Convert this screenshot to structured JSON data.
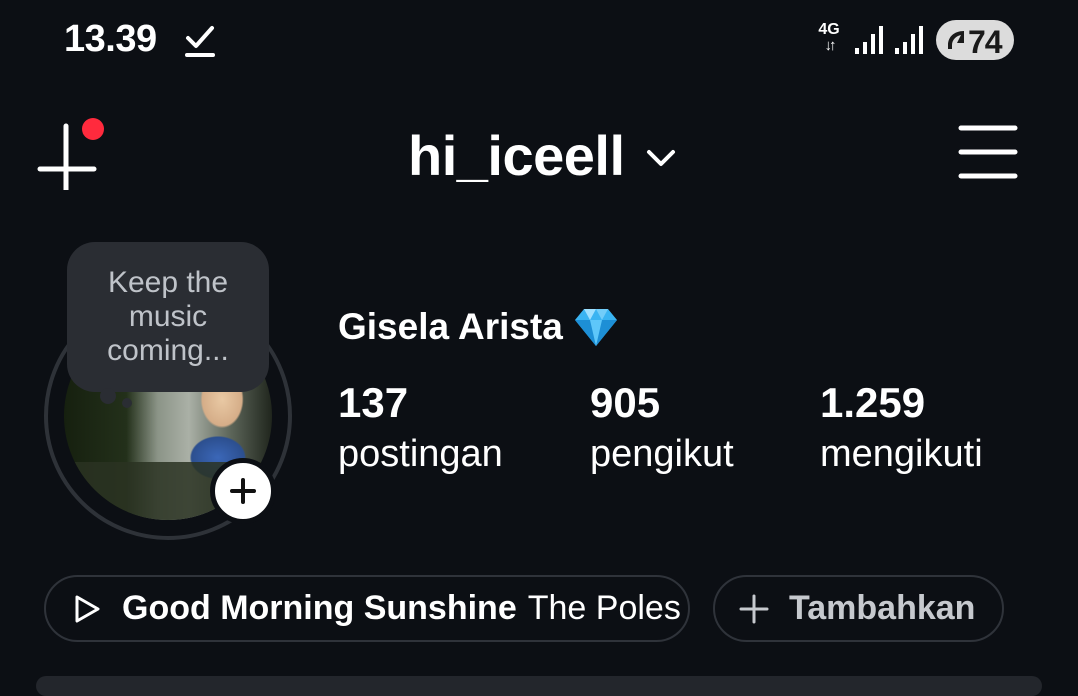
{
  "status_bar": {
    "time": "13.39",
    "network": "4G",
    "network_arrows": "↓↑",
    "battery": "74",
    "icons": [
      "download-done-icon",
      "signal-icon",
      "signal-icon",
      "battery-saver-icon"
    ]
  },
  "header": {
    "username": "hi_iceell",
    "icons": {
      "create": "plus-icon",
      "dropdown": "chevron-down-icon",
      "menu": "hamburger-menu-icon"
    },
    "notification_color": "#ff2a3d"
  },
  "profile": {
    "note": "Keep the music coming...",
    "display_name": "Gisela Arista",
    "name_icon": "diamond-icon",
    "stats": [
      {
        "value": "137",
        "label": "postingan"
      },
      {
        "value": "905",
        "label": "pengikut"
      },
      {
        "value": "1.259",
        "label": "mengikuti"
      }
    ]
  },
  "music": {
    "song": "Good Morning Sunshine",
    "artist": "The Poles",
    "icon": "play-icon"
  },
  "add_button": {
    "label": "Tambahkan",
    "icon": "plus-icon"
  },
  "colors": {
    "background": "#0c0f14",
    "pill_border": "#2f333a",
    "note_bg": "#2a2d33",
    "diamond": "#3ab4f2"
  }
}
